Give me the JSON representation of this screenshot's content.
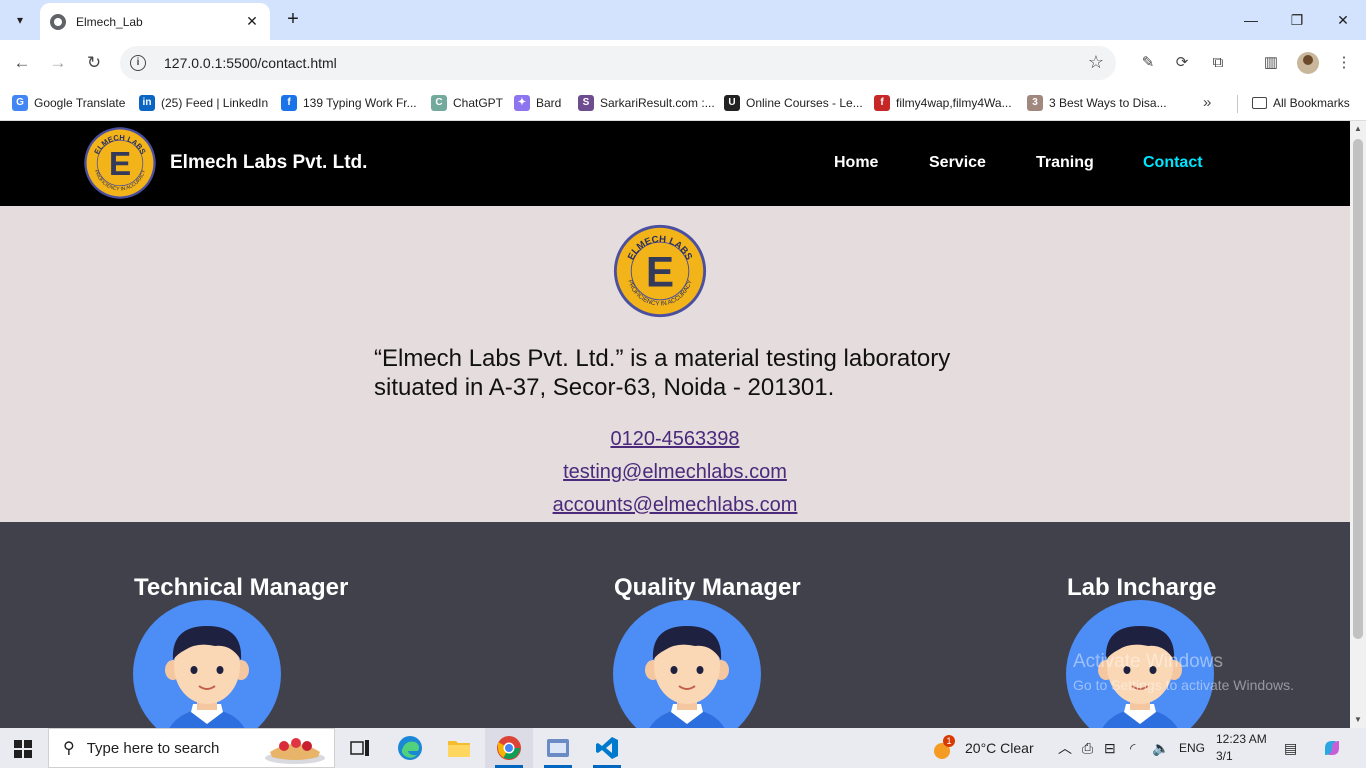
{
  "browser": {
    "tab_title": "Elmech_Lab",
    "url": "127.0.0.1:5500/contact.html",
    "bookmarks": [
      {
        "label": "Google Translate",
        "color": "#4285f4",
        "glyph": "G"
      },
      {
        "label": "(25) Feed | LinkedIn",
        "color": "#0a66c2",
        "glyph": "in"
      },
      {
        "label": "139 Typing Work Fr...",
        "color": "#1a73e8",
        "glyph": "f"
      },
      {
        "label": "ChatGPT",
        "color": "#74aa9c",
        "glyph": "C"
      },
      {
        "label": "Bard",
        "color": "#8e75f0",
        "glyph": "✦"
      },
      {
        "label": "SarkariResult.com :...",
        "color": "#6d4c8f",
        "glyph": "S"
      },
      {
        "label": "Online Courses - Le...",
        "color": "#222222",
        "glyph": "U"
      },
      {
        "label": "filmy4wap,filmy4Wa...",
        "color": "#c62828",
        "glyph": "f"
      },
      {
        "label": "3 Best Ways to Disa...",
        "color": "#a1887f",
        "glyph": "3"
      }
    ],
    "all_bookmarks": "All Bookmarks"
  },
  "site": {
    "brand": "Elmech Labs Pvt. Ltd.",
    "logo_text_top": "ELMECH LABS",
    "logo_text_bottom": "PROFICIENCY IN ACCURACY",
    "logo_letter": "E",
    "nav": [
      {
        "label": "Home",
        "active": false
      },
      {
        "label": "Service",
        "active": false
      },
      {
        "label": "Traning",
        "active": false
      },
      {
        "label": "Contact",
        "active": true
      }
    ],
    "active_color": "#00e5ff",
    "intro": "“Elmech Labs Pvt. Ltd.” is a material testing laboratory situated in A-37, Secor-63, Noida - 201301.",
    "phone": "0120-4563398",
    "email_testing": "testing@elmechlabs.com",
    "email_accounts": "accounts@elmechlabs.com",
    "team": [
      {
        "title": "Technical Manager"
      },
      {
        "title": "Quality Manager"
      },
      {
        "title": "Lab Incharge"
      }
    ]
  },
  "watermark": {
    "line1": "Activate Windows",
    "line2": "Go to Settings to activate Windows."
  },
  "taskbar": {
    "search_placeholder": "Type here to search",
    "weather": "20°C  Clear",
    "weather_badge": "1",
    "language": "ENG",
    "time": "12:23 AM",
    "date": "3/1"
  }
}
